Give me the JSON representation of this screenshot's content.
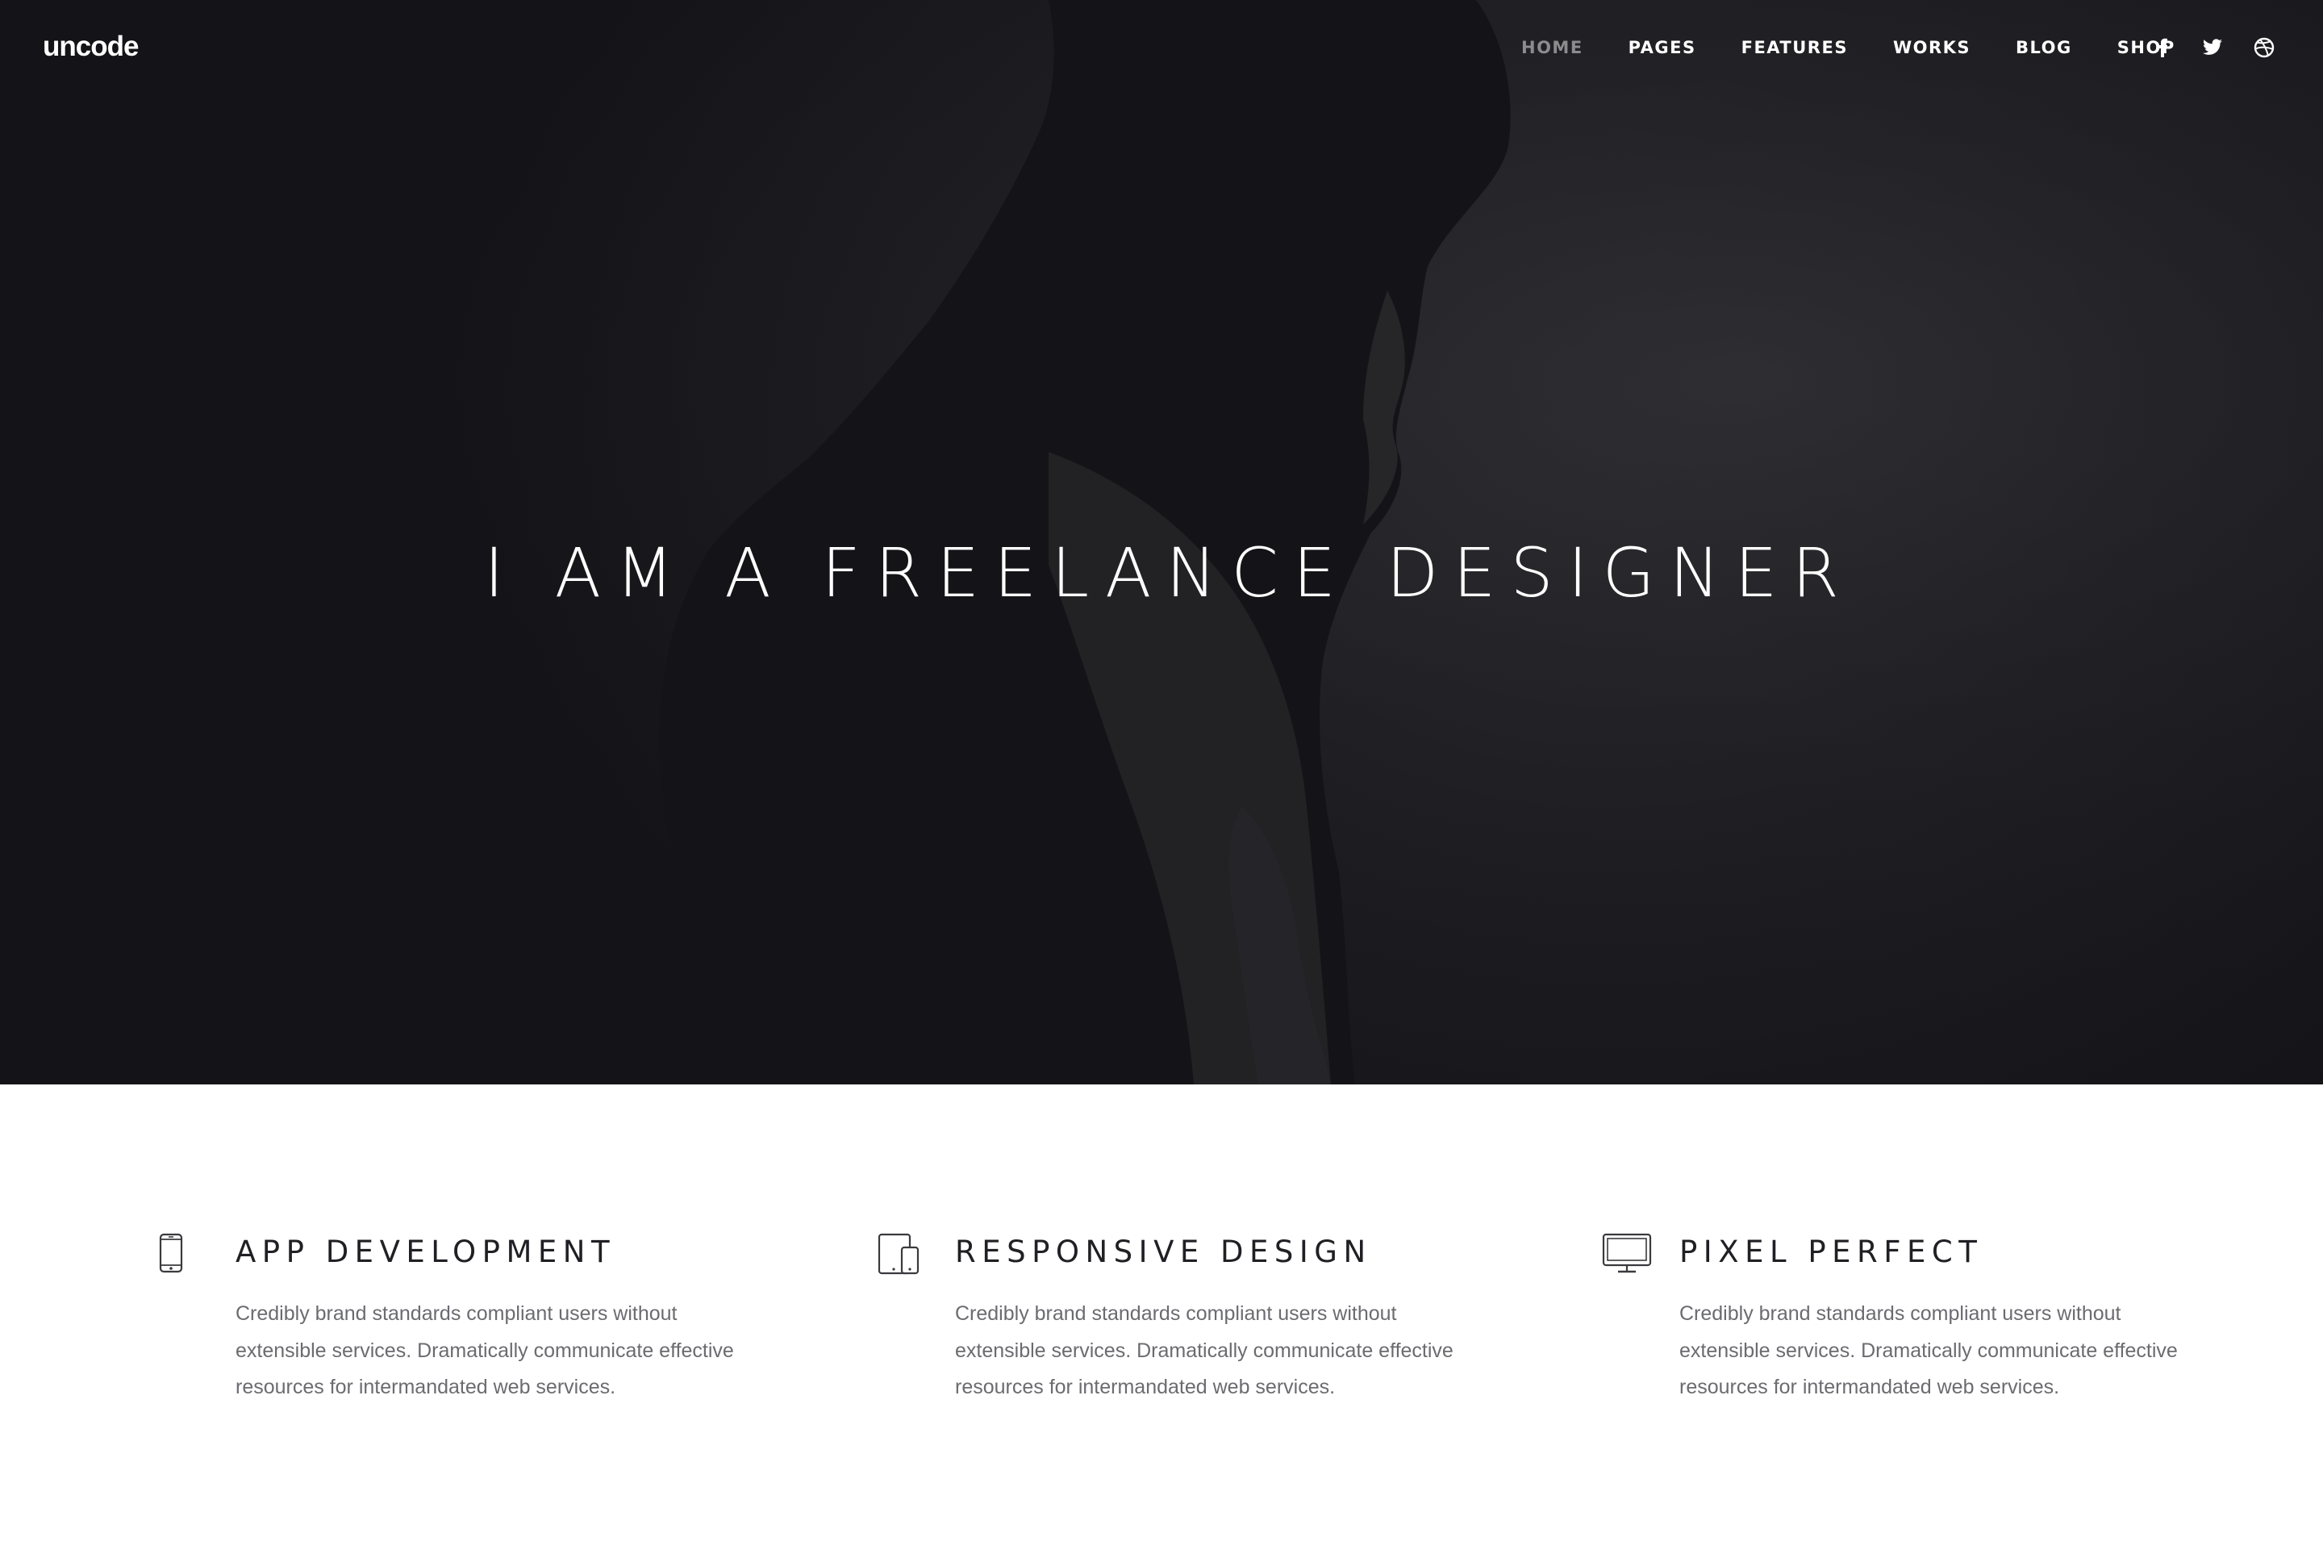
{
  "header": {
    "logo": "uncode",
    "nav": [
      {
        "label": "HOME",
        "active": true
      },
      {
        "label": "PAGES",
        "active": false
      },
      {
        "label": "FEATURES",
        "active": false
      },
      {
        "label": "WORKS",
        "active": false
      },
      {
        "label": "BLOG",
        "active": false
      },
      {
        "label": "SHOP",
        "active": false
      }
    ],
    "social_icons": [
      "facebook-icon",
      "twitter-icon",
      "dribbble-icon"
    ]
  },
  "hero": {
    "title": "I AM A FREELANCE DESIGNER"
  },
  "features": [
    {
      "icon": "smartphone-icon",
      "title": "APP DEVELOPMENT",
      "text": "Credibly brand standards compliant users without extensible services. Dramatically communicate effective resources for intermandated web services."
    },
    {
      "icon": "tablet-phone-icon",
      "title": "RESPONSIVE DESIGN",
      "text": "Credibly brand standards compliant users without extensible services. Dramatically communicate effective resources for intermandated web services."
    },
    {
      "icon": "monitor-icon",
      "title": "PIXEL PERFECT",
      "text": "Credibly brand standards compliant users without extensible services. Dramatically communicate effective resources for intermandated web services."
    }
  ],
  "colors": {
    "hero_background": "#1c1c20",
    "nav_active": "#8c8c8f",
    "heading_text": "#202024",
    "body_text": "#6b6b70"
  }
}
